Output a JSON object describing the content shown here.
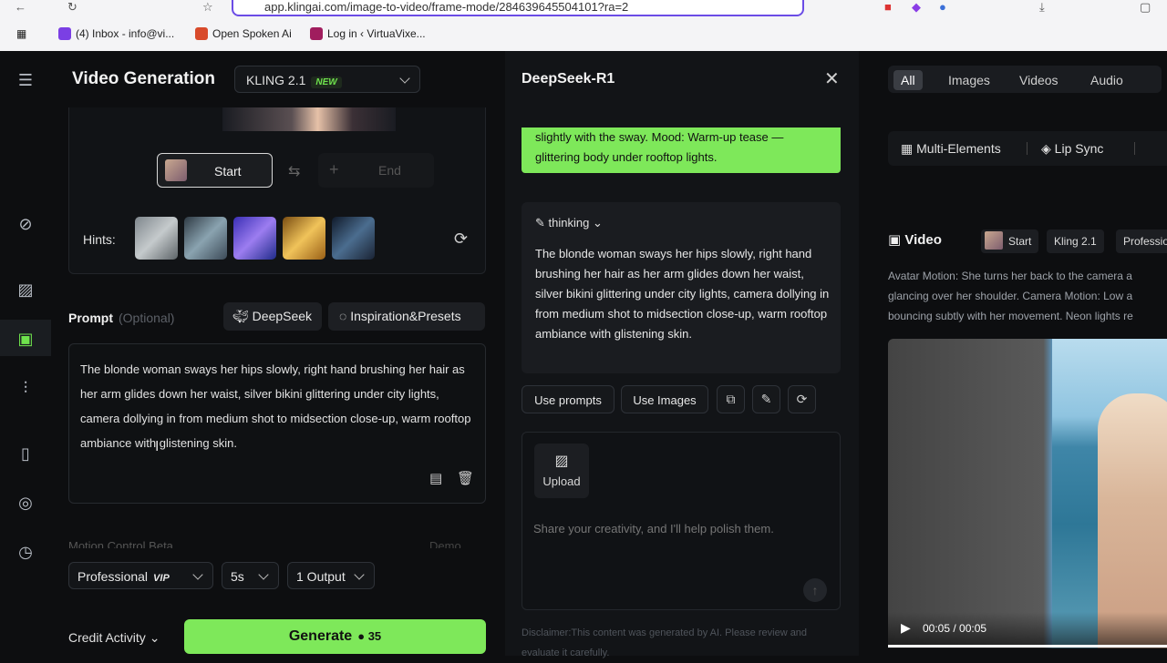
{
  "browser": {
    "url": "app.klingai.com/image-to-video/frame-mode/284639645504101?ra=2",
    "bookmarks": [
      {
        "label": "(4) Inbox - info@vi...",
        "icon_color": "#7b3fe4"
      },
      {
        "label": "Open Spoken Ai",
        "icon_color": "#d84a2b"
      },
      {
        "label": "Log in ‹ VirtuaVixe...",
        "icon_color": "#a01d5e"
      }
    ]
  },
  "app": {
    "title": "Video Generation",
    "model": {
      "name": "KLING 2.1",
      "badge": "NEW"
    },
    "frames": {
      "start_label": "Start",
      "end_label": "End"
    },
    "hints_label": "Hints:",
    "prompt": {
      "label": "Prompt",
      "optional": "(Optional)",
      "deepseek_label": "DeepSeek",
      "inspiration_label": "Inspiration&Presets",
      "text": "The blonde woman sways her hips slowly, right hand brushing her hair as her arm glides down her waist, silver bikini glittering under city lights, camera dollying in from medium shot to midsection close-up, warm rooftop ambiance with glistening skin."
    },
    "motion_control": {
      "label": "Motion Control",
      "badge": "Beta",
      "demo": "Demo"
    },
    "settings": {
      "mode": "Professional",
      "mode_badge": "VIP",
      "duration": "5s",
      "outputs": "1 Output"
    },
    "credit_label": "Credit Activity",
    "generate": {
      "label": "Generate",
      "cost": "35"
    }
  },
  "assistant": {
    "title": "DeepSeek-R1",
    "user_message": "slightly with the sway. Mood: Warm-up tease — glittering body under rooftop lights.",
    "thinking_label": "thinking",
    "response": "The blonde woman sways her hips slowly, right hand brushing her hair as her arm glides down her waist, silver bikini glittering under city lights, camera dollying in from medium shot to midsection close-up, warm rooftop ambiance with glistening skin.",
    "use_prompts_label": "Use prompts",
    "use_images_label": "Use Images",
    "upload_label": "Upload",
    "input_placeholder": "Share your creativity, and I'll help polish them.",
    "disclaimer": "Disclaimer:This content was generated by AI. Please review and evaluate it carefully."
  },
  "library": {
    "tabs": [
      "All",
      "Images",
      "Videos",
      "Audio"
    ],
    "active_tab": "All",
    "tools": [
      "Multi-Elements",
      "Lip Sync"
    ],
    "video_section": "Video",
    "tags": [
      "Start",
      "Kling 2.1",
      "Professio"
    ],
    "description_lines": [
      "Avatar Motion: She turns her back to the camera a",
      "glancing over her shoulder. Camera Motion: Low a",
      "bouncing subtly with her movement. Neon lights re"
    ],
    "video_time": "00:05 / 00:05"
  }
}
